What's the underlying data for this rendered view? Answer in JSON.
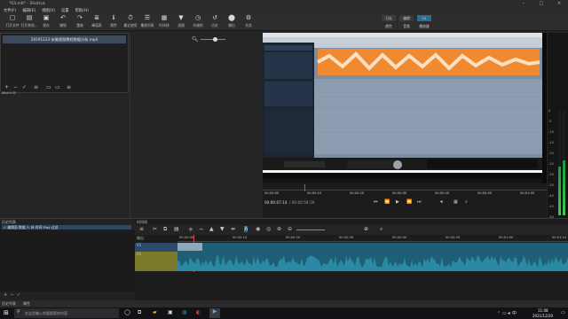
{
  "window": {
    "title": "*03.mlt* - Shotcut",
    "minimize": "–",
    "maximize": "□",
    "close": "×"
  },
  "menu": [
    "文件(F)",
    "编辑(E)",
    "视图(V)",
    "设置",
    "帮助(H)"
  ],
  "toolbar": [
    {
      "icon": "folder-open-icon",
      "glyph": "▢",
      "label": "打开文件"
    },
    {
      "icon": "folder-other-icon",
      "glyph": "▤",
      "label": "打开其他..."
    },
    {
      "icon": "save-icon",
      "glyph": "▣",
      "label": "保存"
    },
    {
      "icon": "undo-icon",
      "glyph": "↶",
      "label": "撤销"
    },
    {
      "icon": "redo-icon",
      "glyph": "↷",
      "label": "重做"
    },
    {
      "icon": "peak-meter-icon",
      "glyph": "≣",
      "label": "峰值表"
    },
    {
      "icon": "properties-icon",
      "glyph": "ℹ",
      "label": "属性"
    },
    {
      "icon": "recent-icon",
      "glyph": "⏱",
      "label": "最近使用"
    },
    {
      "icon": "playlist-icon",
      "glyph": "☰",
      "label": "播放列表"
    },
    {
      "icon": "timeline-icon",
      "glyph": "▦",
      "label": "时间线"
    },
    {
      "icon": "filter-icon",
      "glyph": "▼",
      "label": "滤镜"
    },
    {
      "icon": "keyframes-icon",
      "glyph": "◷",
      "label": "关键帧"
    },
    {
      "icon": "history-icon",
      "glyph": "↺",
      "label": "历史"
    },
    {
      "icon": "export-icon",
      "glyph": "⬤",
      "label": "输出"
    },
    {
      "icon": "jobs-icon",
      "glyph": "⚙",
      "label": "任务"
    }
  ],
  "layouts": {
    "top": [
      "日志",
      "编辑",
      "FX"
    ],
    "bottom": [
      "颜色",
      "音频",
      "播放器"
    ]
  },
  "playlist": {
    "item": "20191213-安徽视频教程数据分析.mp4"
  },
  "panel_tabs": {
    "playlist": "播放列表",
    "filters": "滤镜属性"
  },
  "history": {
    "tab": "历史列表",
    "tab2": "属性",
    "entry": "✓ 编辑面 数据 人 持 时间 Play 过滤"
  },
  "timeline": {
    "tab": "时间线",
    "output_label": "输出",
    "track_v1": "V1",
    "track_a1": "A1",
    "ruler": [
      "00:00:00",
      "00:00:10",
      "00:00:20",
      "00:00:30",
      "00:00:40",
      "00:00:50",
      "00:01:00",
      "00:01:10"
    ]
  },
  "transport": {
    "ruler": [
      "00:00:00",
      "00:00:10",
      "00:00:20",
      "00:00:30",
      "00:00:40",
      "00:00:50",
      "00:01:00"
    ],
    "position": "00:00:07:14",
    "duration": "/ 00:00:58:19"
  },
  "meter": [
    "0",
    "-5",
    "-10",
    "-15",
    "-20",
    "-25",
    "-30",
    "-35",
    "-40",
    "-45",
    "-50"
  ],
  "meter_levels": [
    0.46,
    0.52
  ],
  "taskbar": {
    "search_placeholder": "在这里输入你要搜索的内容",
    "time": "11:08",
    "date": "2021/12/20"
  },
  "colors": {
    "accent": "#2fa8c7",
    "waveform": "#2a8aa4",
    "clip_v1": "#7a7a2a"
  }
}
